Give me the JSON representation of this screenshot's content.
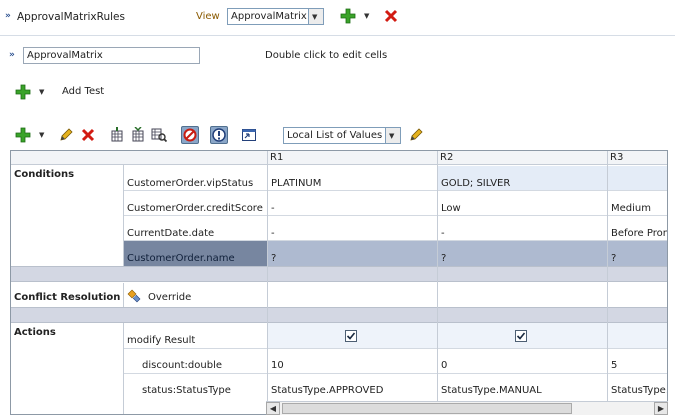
{
  "ruleset": {
    "title": "ApprovalMatrixRules",
    "view_label": "View",
    "view_value": "ApprovalMatrix"
  },
  "decision_table": {
    "name": "ApprovalMatrix",
    "hint": "Double click to edit cells"
  },
  "test": {
    "add_label": "Add Test"
  },
  "toolbar": {
    "lov_value": "Local List of Values"
  },
  "columns": [
    "R1",
    "R2",
    "R3"
  ],
  "conditions": {
    "section_label": "Conditions",
    "rows": [
      {
        "name": "CustomerOrder.vipStatus",
        "values": [
          "PLATINUM",
          "GOLD; SILVER",
          ""
        ]
      },
      {
        "name": "CustomerOrder.creditScore",
        "values": [
          "-",
          "Low",
          "Medium"
        ]
      },
      {
        "name": "CurrentDate.date",
        "values": [
          "-",
          "-",
          "Before Prom"
        ]
      },
      {
        "name": "CustomerOrder.name",
        "values": [
          "?",
          "?",
          "?"
        ]
      }
    ]
  },
  "conflict": {
    "section_label": "Conflict Resolution",
    "value": "Override"
  },
  "actions": {
    "section_label": "Actions",
    "action_name": "modify Result",
    "checked": [
      true,
      true
    ],
    "params": [
      {
        "name": "discount:double",
        "values": [
          "10",
          "0",
          "5"
        ]
      },
      {
        "name": "status:StatusType",
        "values": [
          "StatusType.APPROVED",
          "StatusType.MANUAL",
          "StatusType."
        ]
      }
    ]
  },
  "colors": {
    "accent": "#2a4f8f",
    "selected_row": "#7786a0",
    "selected_row_cells": "#aebad0",
    "highlight_cell": "#e4ecf7"
  }
}
